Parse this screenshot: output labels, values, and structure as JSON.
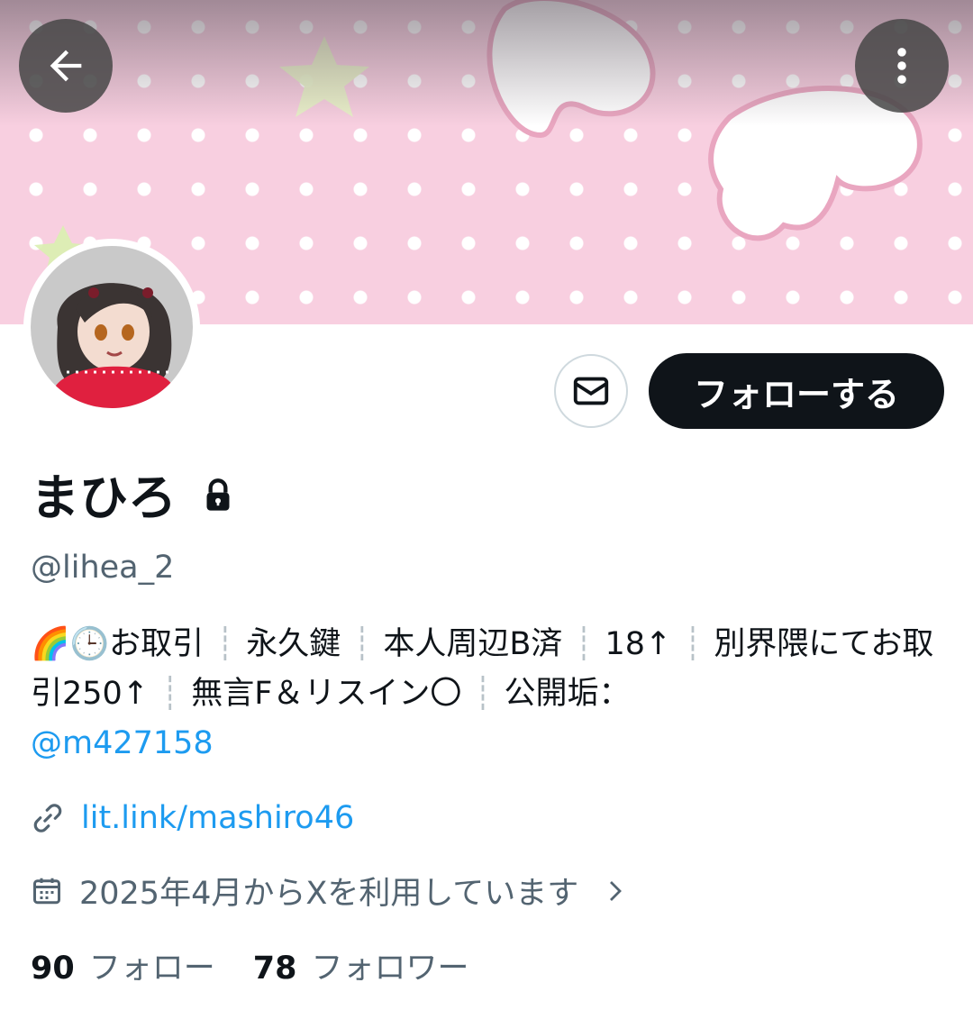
{
  "profile": {
    "display_name": "まひろ",
    "handle": "@lihea_2",
    "follow_label": "フォローする",
    "bio": {
      "emoji": "🌈🕒",
      "items": [
        "お取引",
        "永久鍵",
        "本人周辺B済",
        "18↑",
        "別界隈にてお取引250↑",
        "無言F＆リスイン〇",
        "公開垢："
      ],
      "mention": "@m427158"
    },
    "link": "lit.link/mashiro46",
    "joined": "2025年4月からXを利用しています",
    "stats": {
      "following_count": "90",
      "following_label": "フォロー",
      "followers_count": "78",
      "followers_label": "フォロワー"
    }
  },
  "icons": {
    "back": "arrow-left-icon",
    "more": "more-vertical-icon",
    "message": "mail-icon",
    "protected": "lock-icon",
    "link": "link-icon",
    "calendar": "calendar-icon",
    "chevron": "chevron-right-icon"
  },
  "colors": {
    "accent": "#1d9bf0",
    "text": "#0f1419",
    "secondary": "#536471",
    "banner": "#f8cfe0"
  }
}
